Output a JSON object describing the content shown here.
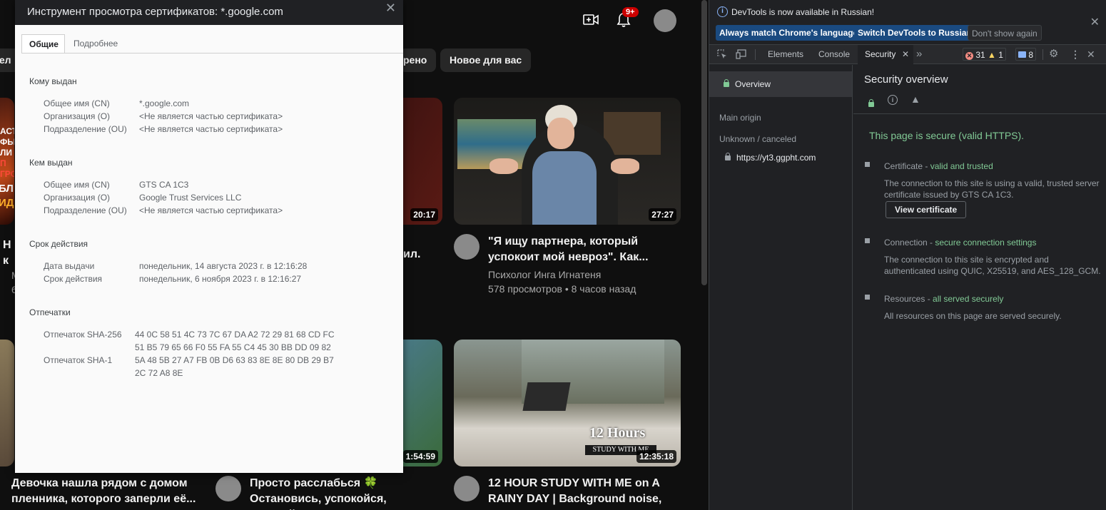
{
  "youtube": {
    "notif_count": "9+",
    "chips": [
      "тел",
      "рено",
      "Новое для вас"
    ],
    "videos": [
      {
        "duration": "20:17",
        "title_partial": "ил."
      },
      {
        "duration": "27:27",
        "title": "\"Я ищу партнера, который успокоит мой невроз\". Как...",
        "channel": "Психолог Инга Игнатеня",
        "meta": "578 просмотров • 8 часов назад"
      },
      {
        "duration": "1:54:59",
        "title": "Просто расслабься 🍀 Остановись, успокойся, успокой"
      },
      {
        "duration": "12:35:18",
        "title": "12 HOUR STUDY WITH ME on A RAINY DAY | Background noise, ..."
      },
      {
        "title": "Девочка нашла рядом с домом пленника, которого заперли её..."
      }
    ],
    "left_thumb_text": [
      "АСТ",
      "ФЫ",
      "ЛИ",
      "П",
      "ГРО",
      "БЛ",
      "ИД"
    ],
    "left_meta": [
      "Н",
      "к",
      "М",
      "6"
    ],
    "thumb_text_12h": "12 Hours",
    "thumb_text_study": "STUDY WITH ME"
  },
  "cert": {
    "title": "Инструмент просмотра сертификатов: *.google.com",
    "tabs": [
      "Общие",
      "Подробнее"
    ],
    "issued_to": {
      "heading": "Кому выдан",
      "rows": [
        {
          "k": "Общее имя (CN)",
          "v": "*.google.com"
        },
        {
          "k": "Организация (O)",
          "v": "<Не является частью сертификата>"
        },
        {
          "k": "Подразделение (OU)",
          "v": "<Не является частью сертификата>"
        }
      ]
    },
    "issued_by": {
      "heading": "Кем выдан",
      "rows": [
        {
          "k": "Общее имя (CN)",
          "v": "GTS CA 1C3"
        },
        {
          "k": "Организация (O)",
          "v": "Google Trust Services LLC"
        },
        {
          "k": "Подразделение (OU)",
          "v": "<Не является частью сертификата>"
        }
      ]
    },
    "validity": {
      "heading": "Срок действия",
      "rows": [
        {
          "k": "Дата выдачи",
          "v": "понедельник, 14 августа 2023 г. в 12:16:28"
        },
        {
          "k": "Срок действия",
          "v": "понедельник, 6 ноября 2023 г. в 12:16:27"
        }
      ]
    },
    "fingerprints": {
      "heading": "Отпечатки",
      "sha256_label": "Отпечаток SHA-256",
      "sha256_l1": "44 0C 58 51 4C 73 7C 67 DA A2 72 29 81 68 CD FC",
      "sha256_l2": "51 B5 79 65 66 F0 55 FA 55 C4 45 30 BB DD 09 82",
      "sha1_label": "Отпечаток SHA-1",
      "sha1_l1": "5A 48 5B 27 A7 FB 0B D6 63 83 8E 8E 80 DB 29 B7",
      "sha1_l2": "2C 72 A8 8E"
    }
  },
  "devtools": {
    "info": "DevTools is now available in Russian!",
    "btn_match": "Always match Chrome's language",
    "btn_switch": "Switch DevTools to Russian",
    "btn_dont": "Don't show again",
    "tabs": {
      "elements": "Elements",
      "console": "Console",
      "security": "Security"
    },
    "errors": "31",
    "warnings": "1",
    "messages": "8",
    "sidebar": {
      "overview": "Overview",
      "main_origin": "Main origin",
      "unknown": "Unknown / canceled",
      "origin_url": "https://yt3.ggpht.com"
    },
    "overview_title": "Security overview",
    "secure_msg": "This page is secure (valid HTTPS).",
    "certificate": {
      "label": "Certificate - ",
      "status": "valid and trusted",
      "desc": "The connection to this site is using a valid, trusted server certificate issued by GTS CA 1C3.",
      "button": "View certificate"
    },
    "connection": {
      "label": "Connection - ",
      "status": "secure connection settings",
      "desc": "The connection to this site is encrypted and authenticated using QUIC, X25519, and AES_128_GCM."
    },
    "resources": {
      "label": "Resources - ",
      "status": "all served securely",
      "desc": "All resources on this page are served securely."
    }
  },
  "colors": {
    "secure_green": "#81c995",
    "link_blue": "#8ab4f8"
  }
}
